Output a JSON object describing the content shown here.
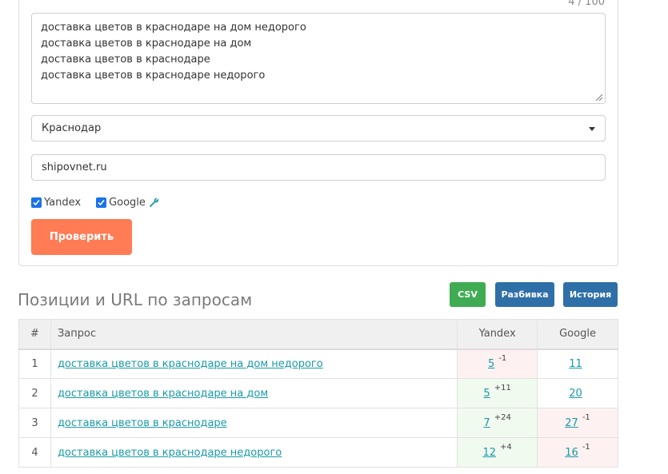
{
  "form": {
    "counter": "4 / 100",
    "queries": [
      "доставка цветов в краснодаре на дом недорого",
      "доставка цветов в краснодаре на дом",
      "доставка цветов в краснодаре",
      "доставка цветов в краснодаре недорого"
    ],
    "region": "Краснодар",
    "domain": "shipovnet.ru",
    "engines": {
      "yandex": {
        "label": "Yandex",
        "checked": true
      },
      "google": {
        "label": "Google",
        "checked": true
      }
    },
    "submit_label": "Проверить"
  },
  "results": {
    "title": "Позиции и URL по запросам",
    "buttons": {
      "csv": "CSV",
      "split": "Разбивка",
      "history": "История"
    },
    "columns": {
      "num": "#",
      "query": "Запрос",
      "yandex": "Yandex",
      "google": "Google"
    },
    "rows": [
      {
        "num": "1",
        "query": "доставка цветов в краснодаре на дом недорого",
        "yandex": "5",
        "yandex_delta": "-1",
        "google": "11",
        "google_delta": ""
      },
      {
        "num": "2",
        "query": "доставка цветов в краснодаре на дом",
        "yandex": "5",
        "yandex_delta": "+11",
        "google": "20",
        "google_delta": ""
      },
      {
        "num": "3",
        "query": "доставка цветов в краснодаре",
        "yandex": "7",
        "yandex_delta": "+24",
        "google": "27",
        "google_delta": "-1"
      },
      {
        "num": "4",
        "query": "доставка цветов в краснодаре недорого",
        "yandex": "12",
        "yandex_delta": "+4",
        "google": "16",
        "google_delta": "-1"
      }
    ]
  },
  "colors": {
    "accent_orange": "#ff7c54",
    "csv_green": "#3fac54",
    "button_blue": "#2f6fa8",
    "link_teal": "#1a9aa6",
    "cell_red_bg": "#fdf1f1",
    "cell_green_bg": "#f1faef"
  }
}
